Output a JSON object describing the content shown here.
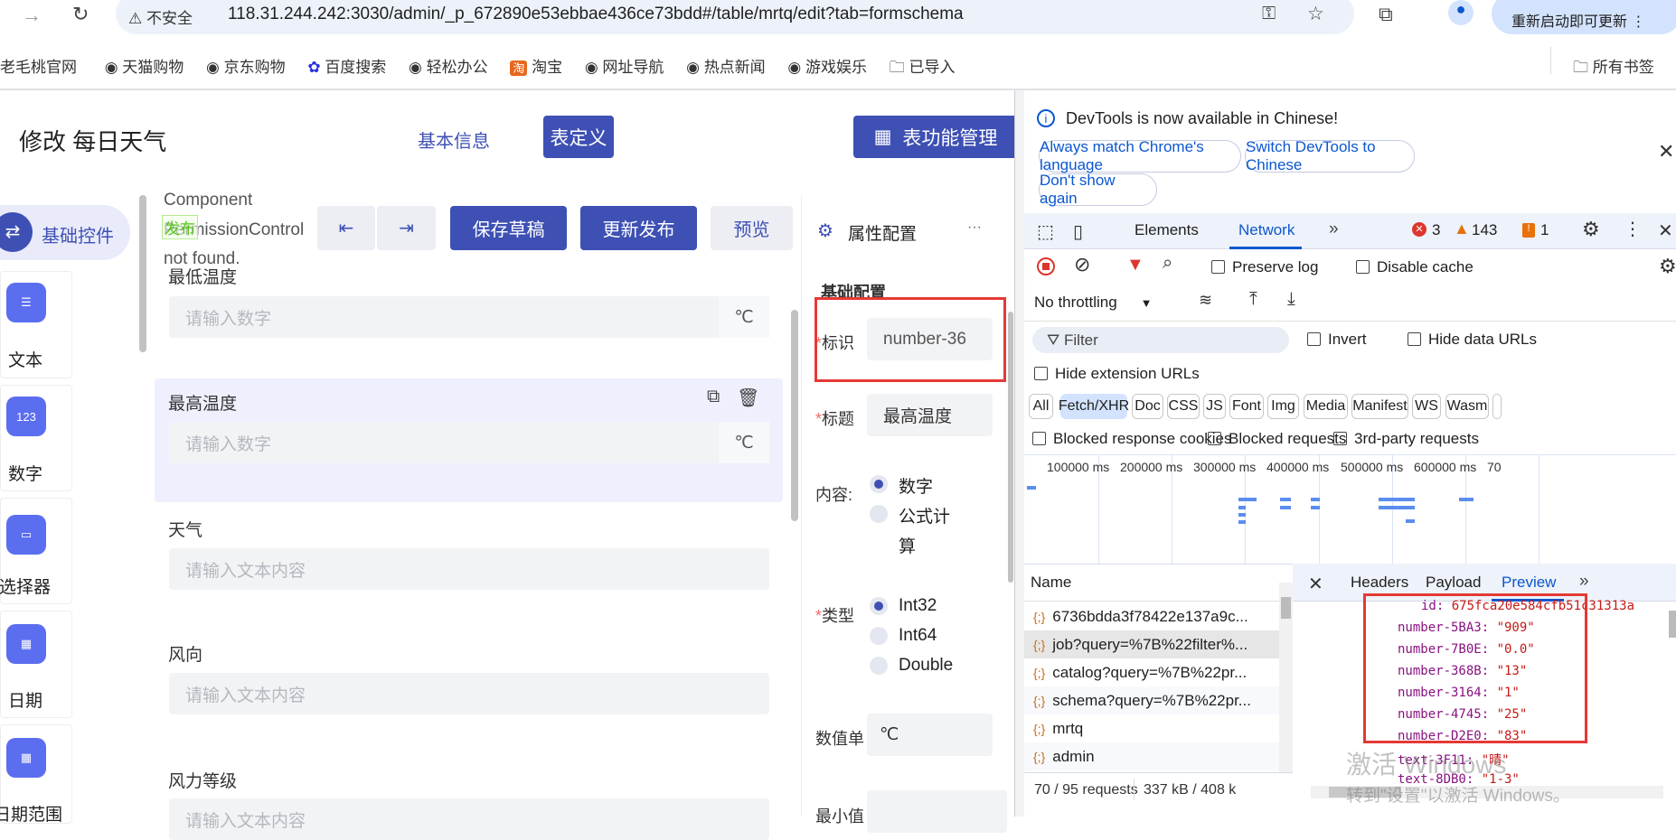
{
  "browser": {
    "security": "不安全",
    "url": "118.31.244.242:3030/admin/_p_672890e53ebbae436ce73bdd#/table/mrtq/edit?tab=formschema",
    "update_button": "重新启动即可更新",
    "bookmarks": [
      "老毛桃官网",
      "天猫购物",
      "京东购物",
      "百度搜索",
      "轻松办公",
      "淘宝",
      "网址导航",
      "热点新闻",
      "游戏娱乐",
      "已导入"
    ],
    "all_bookmarks": "所有书签"
  },
  "app": {
    "title": "修改 每日天气",
    "tabs": {
      "basic": "基本信息",
      "schema": "表定义"
    },
    "func_button": "表功能管理",
    "error_text": [
      "Component",
      "PermissionControl",
      "not found."
    ],
    "error_tag": "发布",
    "sidebar": {
      "group": "基础控件",
      "items": [
        {
          "label": "文本",
          "icon": "text-icon"
        },
        {
          "label": "数字",
          "icon": "123"
        },
        {
          "label": "选择器",
          "icon": "select-icon"
        },
        {
          "label": "日期",
          "icon": "calendar-icon"
        },
        {
          "label": "日期范围",
          "icon": "date-range-icon"
        }
      ]
    },
    "toolbar": {
      "save": "保存草稿",
      "publish": "更新发布",
      "preview": "预览"
    },
    "fields": [
      {
        "label": "最低温度",
        "placeholder": "请输入数字",
        "unit": "℃"
      },
      {
        "label": "最高温度",
        "placeholder": "请输入数字",
        "unit": "℃",
        "selected": true
      },
      {
        "label": "天气",
        "placeholder": "请输入文本内容"
      },
      {
        "label": "风向",
        "placeholder": "请输入文本内容"
      },
      {
        "label": "风力等级",
        "placeholder": "请输入文本内容"
      }
    ],
    "props": {
      "title": "属性配置",
      "more": "···",
      "section": "基础配置",
      "id_label": "标识",
      "id_value": "number-36",
      "title_label": "标题",
      "title_value": "最高温度",
      "content_label": "内容:",
      "content_options": [
        "数字",
        "公式计",
        "算"
      ],
      "type_label": "类型",
      "type_options": [
        "Int32",
        "Int64",
        "Double"
      ],
      "unit_label": "数值单",
      "unit_value": "℃",
      "min_label": "最小值"
    }
  },
  "devtools": {
    "banner": "DevTools is now available in Chinese!",
    "btn_match": "Always match Chrome's language",
    "btn_switch": "Switch DevTools to Chinese",
    "btn_dont": "Don't show again",
    "tabs": [
      "Elements",
      "Network"
    ],
    "errors": "3",
    "warnings": "143",
    "issues": "1",
    "preserve_log": "Preserve log",
    "disable_cache": "Disable cache",
    "throttling": "No throttling",
    "filter_placeholder": "Filter",
    "invert": "Invert",
    "hide_data": "Hide data URLs",
    "hide_ext": "Hide extension URLs",
    "types": [
      "All",
      "Fetch/XHR",
      "Doc",
      "CSS",
      "JS",
      "Font",
      "Img",
      "Media",
      "Manifest",
      "WS",
      "Wasm"
    ],
    "active_type": "Fetch/XHR",
    "blocked": [
      "Blocked response cookies",
      "Blocked requests",
      "3rd-party requests"
    ],
    "ticks": [
      "100000 ms",
      "200000 ms",
      "300000 ms",
      "400000 ms",
      "500000 ms",
      "600000 ms",
      "70"
    ],
    "name_header": "Name",
    "requests": [
      "6736bdda3f78422e137a9c...",
      "job?query=%7B%22filter%...",
      "catalog?query=%7B%22pr...",
      "schema?query=%7B%22pr...",
      "mrtq",
      "admin"
    ],
    "detail_tabs": [
      "Headers",
      "Payload",
      "Preview"
    ],
    "active_detail": "Preview",
    "preview": [
      [
        "id",
        "675fca20e584cfb51c31313a"
      ],
      [
        "number-5BA3",
        "\"909\""
      ],
      [
        "number-7B0E",
        "\"0.0\""
      ],
      [
        "number-368B",
        "\"13\""
      ],
      [
        "number-3164",
        "\"1\""
      ],
      [
        "number-4745",
        "\"25\""
      ],
      [
        "number-D2E0",
        "\"83\""
      ],
      [
        "text-3F11",
        "\"晴\""
      ],
      [
        "text-8DB0",
        "\"1-3\""
      ]
    ],
    "footer_requests": "70 / 95 requests",
    "footer_size": "337 kB / 408 k"
  },
  "watermark": {
    "line1": "激活 Windows",
    "line2": "转到\"设置\"以激活 Windows。"
  },
  "colors": {
    "primary": "#3e50b4",
    "highlight": "#e53935",
    "devtools_accent": "#0b57d0"
  }
}
